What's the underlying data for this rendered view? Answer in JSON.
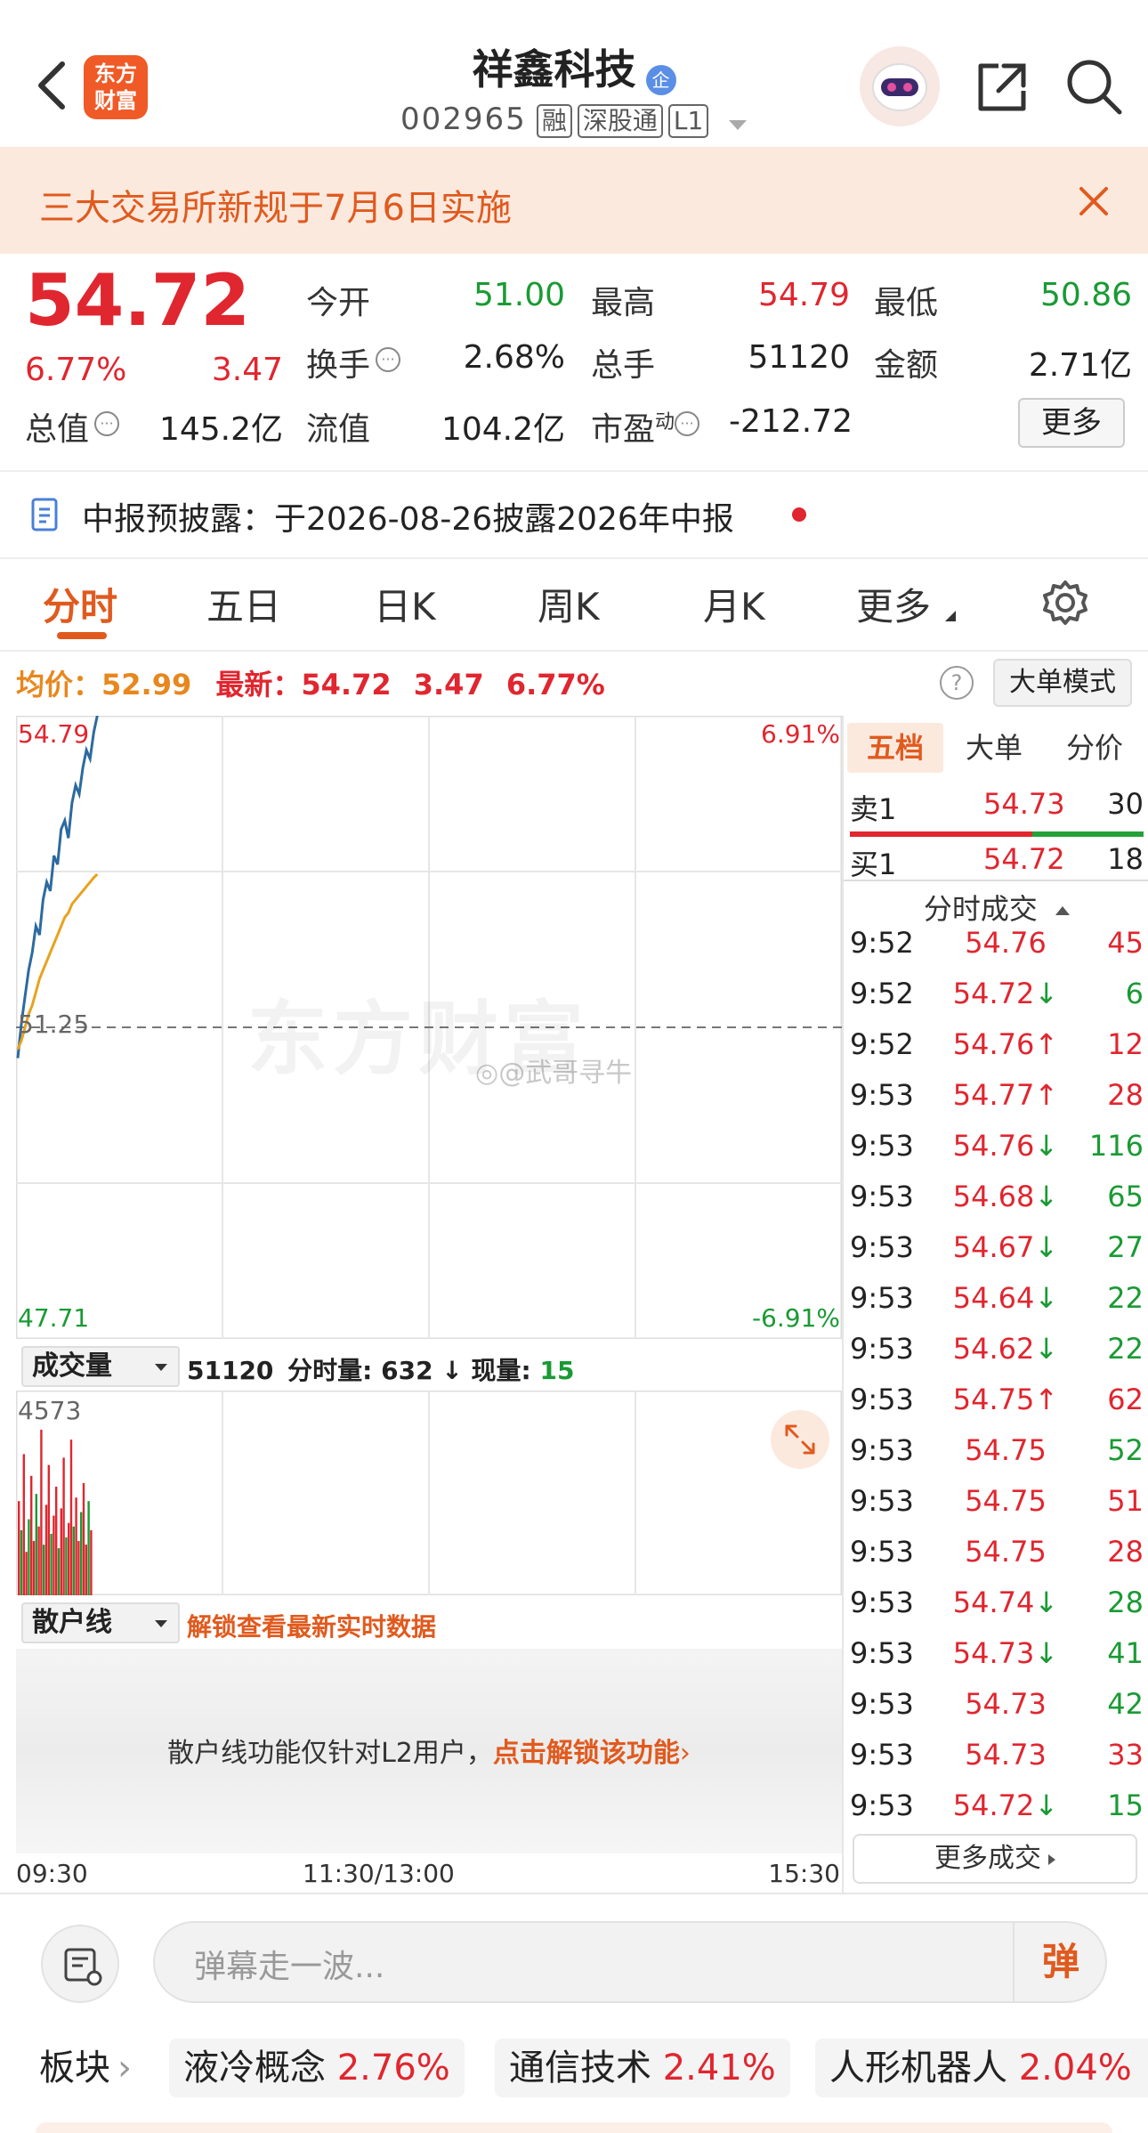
{
  "header": {
    "logo_line1": "东方",
    "logo_line2": "财富",
    "stock_name": "祥鑫科技",
    "badge": "企",
    "stock_code": "002965",
    "tags": [
      "融",
      "深股通",
      "L1"
    ]
  },
  "notice": {
    "text": "三大交易所新规于7月6日实施"
  },
  "quote": {
    "price": "54.72",
    "change_pct": "6.77%",
    "change": "3.47",
    "stats": [
      {
        "label": "今开",
        "value": "51.00",
        "color": "green"
      },
      {
        "label": "最高",
        "value": "54.79",
        "color": "red"
      },
      {
        "label": "最低",
        "value": "50.86",
        "color": "green"
      },
      {
        "label": "换手",
        "value": "2.68%",
        "color": "dark"
      },
      {
        "label": "总手",
        "value": "51120",
        "color": "dark"
      },
      {
        "label": "金额",
        "value": "2.71亿",
        "color": "dark"
      },
      {
        "label": "总值",
        "value": "145.2亿",
        "color": "dark"
      },
      {
        "label": "流值",
        "value": "104.2亿",
        "color": "dark"
      },
      {
        "label": "市盈",
        "sup": "动",
        "value": "-212.72",
        "color": "dark"
      }
    ],
    "more_button": "更多"
  },
  "disclosure": {
    "text": "中报预披露：于2026-08-26披露2026年中报"
  },
  "tabs": [
    "分时",
    "五日",
    "日K",
    "周K",
    "月K",
    "更多"
  ],
  "chart_info": {
    "avg_label": "均价：",
    "avg_value": "52.99",
    "latest_label": "最新：",
    "latest_value": "54.72",
    "latest_change": "3.47",
    "latest_pct": "6.77%",
    "mode_button": "大单模式"
  },
  "chart_data": {
    "type": "line",
    "y_max_label": "54.79",
    "y_mid_label": "51.25",
    "y_min_label": "47.71",
    "pct_max_label": "6.91%",
    "pct_min_label": "-6.91%",
    "ylim": [
      47.71,
      54.79
    ],
    "prev_close": 51.25,
    "x_labels": [
      "09:30",
      "11:30/13:00",
      "15:30"
    ],
    "series": [
      {
        "color": "#2c6aa0",
        "values": [
          50.9,
          51.3,
          51.6,
          51.9,
          52.1,
          52.4,
          52.3,
          52.7,
          52.9,
          52.8,
          53.2,
          53.1,
          53.5,
          53.6,
          53.4,
          53.8,
          54.0,
          53.9,
          54.2,
          54.4,
          54.3,
          54.6,
          54.79
        ]
      },
      {
        "color": "#e8a21e",
        "values": [
          51.0,
          51.1,
          51.25,
          51.4,
          51.5,
          51.65,
          51.8,
          51.9,
          52.0,
          52.1,
          52.2,
          52.3,
          52.4,
          52.5,
          52.55,
          52.65,
          52.7,
          52.75,
          52.8,
          52.85,
          52.9,
          52.95,
          52.99
        ]
      }
    ]
  },
  "volume": {
    "dropdown": "成交量",
    "total": "51120",
    "fen_label": "分时量:",
    "fen_value": "632",
    "now_label": "现量:",
    "now_value": "15",
    "max_label": "4573",
    "max_value": 4573,
    "bars": [
      2600,
      1800,
      3900,
      1200,
      2100,
      3300,
      1500,
      2800,
      1900,
      4573,
      1400,
      2500,
      3600,
      1700,
      2200,
      3000,
      1300,
      2400,
      3800,
      1600,
      2000,
      4300,
      1900,
      2700,
      1500,
      2300,
      3100,
      1400,
      2600,
      1800
    ]
  },
  "retail": {
    "dropdown": "散户线",
    "unlock_hint": "解锁查看最新实时数据",
    "lock_text": "散户线功能仅针对L2用户，",
    "lock_link": "点击解锁该功能"
  },
  "order_book": {
    "tabs": [
      "五档",
      "大单",
      "分价"
    ],
    "sell_label": "卖1",
    "sell_price": "54.73",
    "sell_vol": "30",
    "buy_label": "买1",
    "buy_price": "54.72",
    "buy_vol": "18",
    "trades_title": "分时成交",
    "trades": [
      {
        "time": "9:52",
        "price": "54.76",
        "arrow": "",
        "vol": "45",
        "vc": "red"
      },
      {
        "time": "9:52",
        "price": "54.72",
        "arrow": "↓",
        "vol": "6",
        "vc": "green"
      },
      {
        "time": "9:52",
        "price": "54.76",
        "arrow": "↑",
        "vol": "12",
        "vc": "red"
      },
      {
        "time": "9:53",
        "price": "54.77",
        "arrow": "↑",
        "vol": "28",
        "vc": "red"
      },
      {
        "time": "9:53",
        "price": "54.76",
        "arrow": "↓",
        "vol": "116",
        "vc": "green"
      },
      {
        "time": "9:53",
        "price": "54.68",
        "arrow": "↓",
        "vol": "65",
        "vc": "green"
      },
      {
        "time": "9:53",
        "price": "54.67",
        "arrow": "↓",
        "vol": "27",
        "vc": "green"
      },
      {
        "time": "9:53",
        "price": "54.64",
        "arrow": "↓",
        "vol": "22",
        "vc": "green"
      },
      {
        "time": "9:53",
        "price": "54.62",
        "arrow": "↓",
        "vol": "22",
        "vc": "green"
      },
      {
        "time": "9:53",
        "price": "54.75",
        "arrow": "↑",
        "vol": "62",
        "vc": "red"
      },
      {
        "time": "9:53",
        "price": "54.75",
        "arrow": "",
        "vol": "52",
        "vc": "green"
      },
      {
        "time": "9:53",
        "price": "54.75",
        "arrow": "",
        "vol": "51",
        "vc": "red"
      },
      {
        "time": "9:53",
        "price": "54.75",
        "arrow": "",
        "vol": "28",
        "vc": "red"
      },
      {
        "time": "9:53",
        "price": "54.74",
        "arrow": "↓",
        "vol": "28",
        "vc": "green"
      },
      {
        "time": "9:53",
        "price": "54.73",
        "arrow": "↓",
        "vol": "41",
        "vc": "green"
      },
      {
        "time": "9:53",
        "price": "54.73",
        "arrow": "",
        "vol": "42",
        "vc": "green"
      },
      {
        "time": "9:53",
        "price": "54.73",
        "arrow": "",
        "vol": "33",
        "vc": "red"
      },
      {
        "time": "9:53",
        "price": "54.72",
        "arrow": "↓",
        "vol": "15",
        "vc": "green"
      }
    ],
    "more_trades": "更多成交"
  },
  "watermark": {
    "brand": "东方财富",
    "handle": "@武哥寻牛"
  },
  "comment": {
    "placeholder": "弹幕走一波...",
    "bullet_button": "弹"
  },
  "sectors": {
    "label": "板块",
    "items": [
      {
        "name": "液冷概念",
        "pct": "2.76%"
      },
      {
        "name": "通信技术",
        "pct": "2.41%"
      },
      {
        "name": "人形机器人",
        "pct": "2.04%"
      }
    ]
  }
}
